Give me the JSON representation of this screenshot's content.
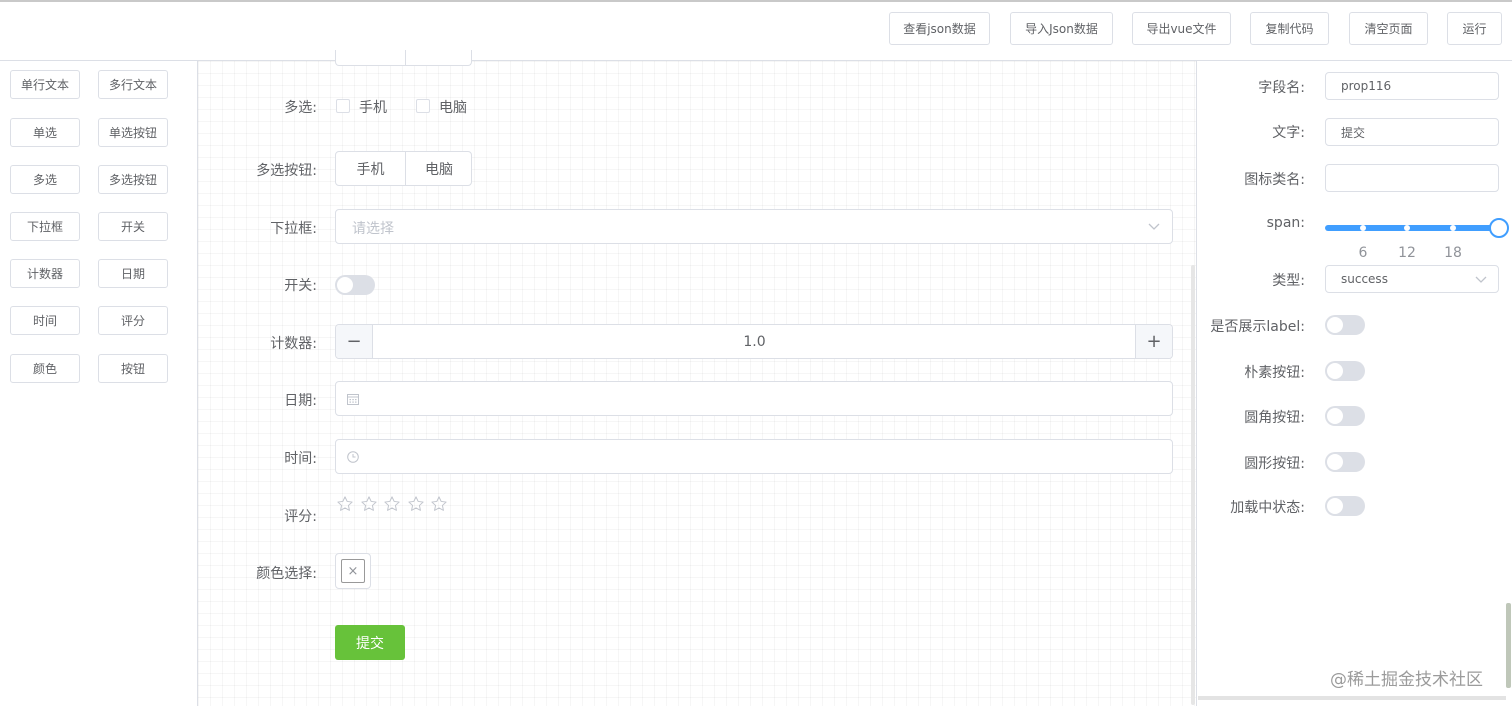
{
  "toolbar": {
    "buttons": [
      "查看json数据",
      "导入Json数据",
      "导出vue文件",
      "复制代码",
      "清空页面",
      "运行"
    ]
  },
  "palette": {
    "items": [
      "单行文本",
      "多行文本",
      "单选",
      "单选按钮",
      "多选",
      "多选按钮",
      "下拉框",
      "开关",
      "计数器",
      "日期",
      "时间",
      "评分",
      "颜色",
      "按钮"
    ]
  },
  "form": {
    "checkbox": {
      "label": "多选:",
      "options": [
        "手机",
        "电脑"
      ]
    },
    "checkbox_button": {
      "label": "多选按钮:",
      "options": [
        "手机",
        "电脑"
      ]
    },
    "select": {
      "label": "下拉框:",
      "placeholder": "请选择"
    },
    "switch": {
      "label": "开关:"
    },
    "counter": {
      "label": "计数器:",
      "value": "1.0",
      "minus": "−",
      "plus": "+"
    },
    "date": {
      "label": "日期:"
    },
    "time": {
      "label": "时间:"
    },
    "rate": {
      "label": "评分:",
      "stars": 5,
      "value": 0
    },
    "color": {
      "label": "颜色选择:",
      "clear": "×"
    },
    "submit": {
      "label": "提交",
      "color": "#67c23a"
    }
  },
  "props": {
    "field_name": {
      "label": "字段名:",
      "value": "prop116"
    },
    "text": {
      "label": "文字:",
      "value": "提交"
    },
    "icon_class": {
      "label": "图标类名:",
      "value": ""
    },
    "span": {
      "label": "span:",
      "ticks": [
        "6",
        "12",
        "18"
      ],
      "value": 24,
      "max": 24,
      "color": "#409eff"
    },
    "type": {
      "label": "类型:",
      "value": "success"
    },
    "show_label": {
      "label": "是否展示label:",
      "on": false
    },
    "plain": {
      "label": "朴素按钮:",
      "on": false
    },
    "round": {
      "label": "圆角按钮:",
      "on": false
    },
    "circle": {
      "label": "圆形按钮:",
      "on": false
    },
    "loading": {
      "label": "加载中状态:",
      "on": false
    }
  },
  "watermark": "@稀土掘金技术社区"
}
